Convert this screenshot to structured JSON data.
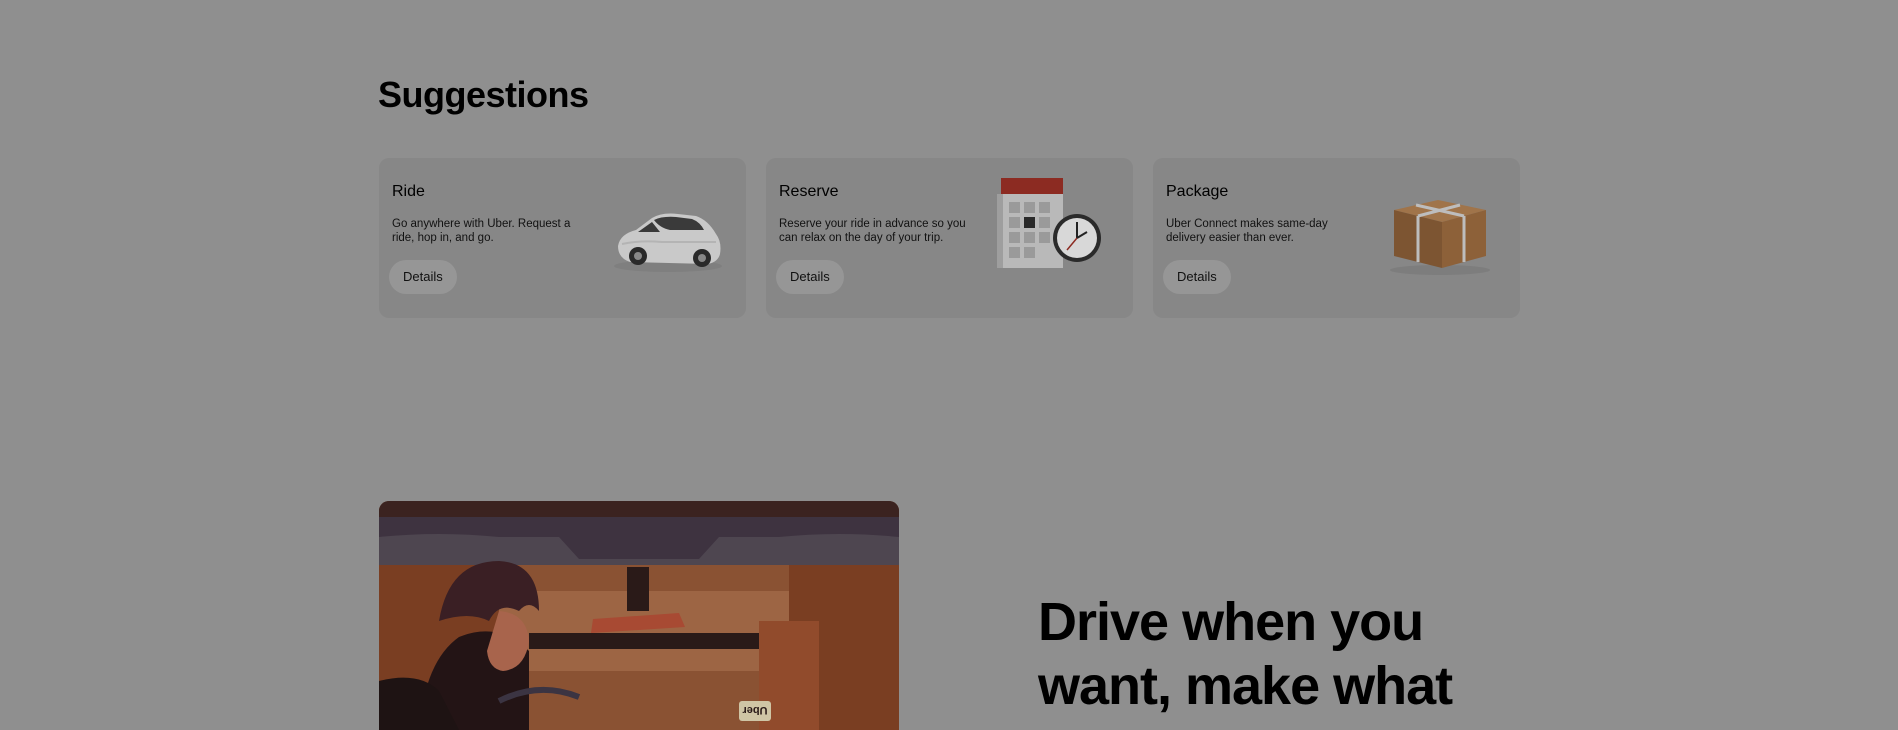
{
  "suggestions": {
    "title": "Suggestions",
    "cards": [
      {
        "title": "Ride",
        "description": "Go anywhere with Uber. Request a ride, hop in, and go.",
        "button_label": "Details",
        "icon": "car-icon"
      },
      {
        "title": "Reserve",
        "description": "Reserve your ride in advance so you can relax on the day of your trip.",
        "button_label": "Details",
        "icon": "calendar-clock-icon"
      },
      {
        "title": "Package",
        "description": "Uber Connect makes same-day delivery easier than ever.",
        "button_label": "Details",
        "icon": "package-icon"
      }
    ]
  },
  "drive": {
    "heading": "Drive when you want, make what",
    "image_sign_text": "Uber"
  }
}
